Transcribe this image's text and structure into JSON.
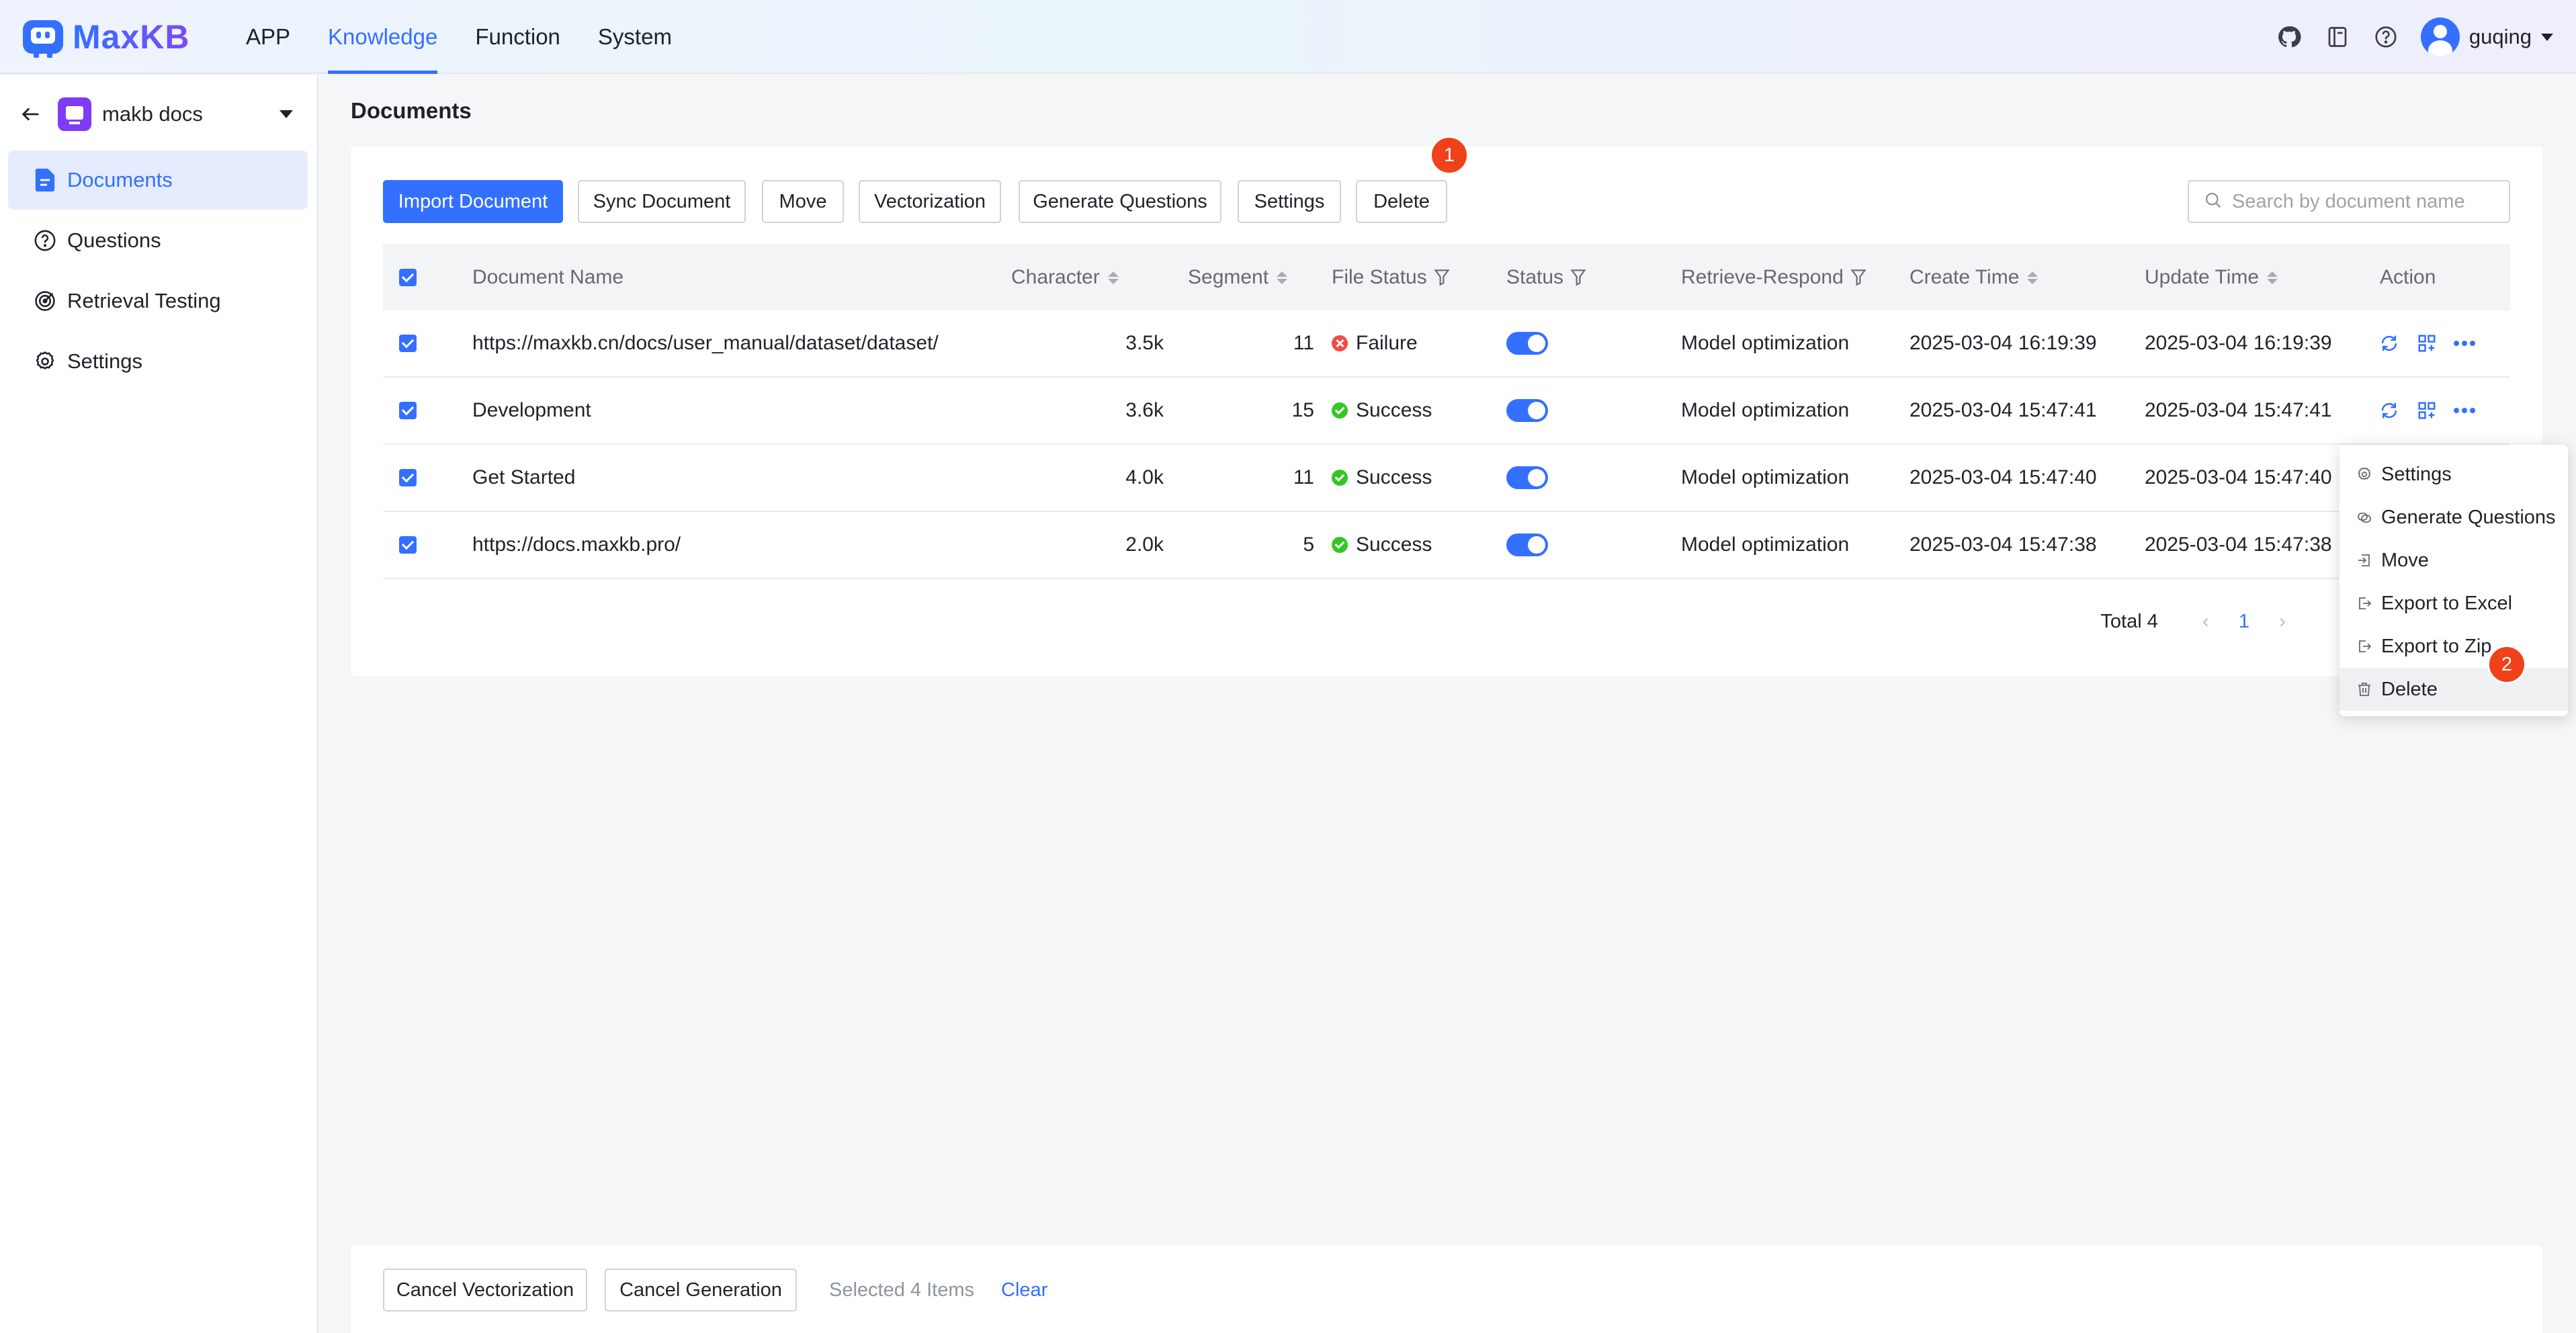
{
  "brand": {
    "name": "MaxKB"
  },
  "nav": [
    {
      "label": "APP",
      "active": false
    },
    {
      "label": "Knowledge",
      "active": true
    },
    {
      "label": "Function",
      "active": false
    },
    {
      "label": "System",
      "active": false
    }
  ],
  "user": {
    "name": "guqing"
  },
  "top_icons": [
    "github-icon",
    "book-icon",
    "help-icon"
  ],
  "sidebar": {
    "kb_name": "makb docs",
    "items": [
      {
        "label": "Documents",
        "icon": "document-icon",
        "active": true
      },
      {
        "label": "Questions",
        "icon": "question-icon",
        "active": false
      },
      {
        "label": "Retrieval Testing",
        "icon": "target-icon",
        "active": false
      },
      {
        "label": "Settings",
        "icon": "gear-icon",
        "active": false
      }
    ]
  },
  "page": {
    "title": "Documents"
  },
  "toolbar": {
    "import": "Import Document",
    "sync": "Sync Document",
    "move": "Move",
    "vectorization": "Vectorization",
    "generate_questions": "Generate Questions",
    "settings": "Settings",
    "delete": "Delete",
    "badge": "1"
  },
  "search": {
    "placeholder": "Search by document name",
    "value": ""
  },
  "table": {
    "headers": {
      "name": "Document Name",
      "character": "Character",
      "segment": "Segment",
      "file_status": "File Status",
      "status": "Status",
      "retrieve": "Retrieve-Respond",
      "create_time": "Create Time",
      "update_time": "Update Time",
      "action": "Action"
    },
    "rows": [
      {
        "name": "https://maxkb.cn/docs/user_manual/dataset/dataset/",
        "character": "3.5k",
        "segment": "11",
        "file_status": "Failure",
        "enabled": true,
        "retrieve": "Model optimization",
        "create_time": "2025-03-04 16:19:39",
        "update_time": "2025-03-04 16:19:39"
      },
      {
        "name": "Development",
        "character": "3.6k",
        "segment": "15",
        "file_status": "Success",
        "enabled": true,
        "retrieve": "Model optimization",
        "create_time": "2025-03-04 15:47:41",
        "update_time": "2025-03-04 15:47:41"
      },
      {
        "name": "Get Started",
        "character": "4.0k",
        "segment": "11",
        "file_status": "Success",
        "enabled": true,
        "retrieve": "Model optimization",
        "create_time": "2025-03-04 15:47:40",
        "update_time": "2025-03-04 15:47:40"
      },
      {
        "name": "https://docs.maxkb.pro/",
        "character": "2.0k",
        "segment": "5",
        "file_status": "Success",
        "enabled": true,
        "retrieve": "Model optimization",
        "create_time": "2025-03-04 15:47:38",
        "update_time": "2025-03-04 15:47:38"
      }
    ]
  },
  "pagination": {
    "total_label": "Total 4",
    "current": "1",
    "prev": "‹",
    "next": "›"
  },
  "dropdown": {
    "items": [
      {
        "label": "Settings",
        "icon": "gear-icon"
      },
      {
        "label": "Generate Questions",
        "icon": "copy-icon"
      },
      {
        "label": "Move",
        "icon": "move-icon"
      },
      {
        "label": "Export to Excel",
        "icon": "export-icon"
      },
      {
        "label": "Export to Zip",
        "icon": "export-icon"
      },
      {
        "label": "Delete",
        "icon": "trash-icon"
      }
    ],
    "badge": "2"
  },
  "bottom": {
    "cancel_vectorization": "Cancel Vectorization",
    "cancel_generation": "Cancel Generation",
    "selected": "Selected 4 Items",
    "clear": "Clear"
  },
  "colors": {
    "primary": "#3370ff",
    "success": "#34c724",
    "failure": "#f54a45",
    "badge": "#f0411a"
  }
}
